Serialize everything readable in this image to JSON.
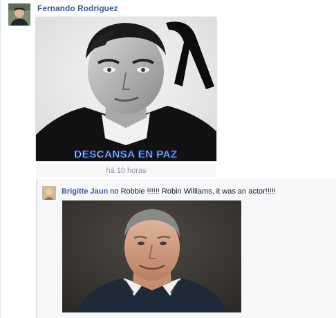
{
  "post": {
    "author": "Fernando Rodriguez",
    "photo_caption": "DESCANSA EN PAZ",
    "timestamp": "há 10 horas"
  },
  "comment": {
    "author": "Brigitte Jaun",
    "text": "no Robbie !!!!!! Robin Williams, it was an actor!!!!!"
  },
  "colors": {
    "link_blue": "#3b5998",
    "meta_gray": "#90949c",
    "panel_bg": "#f6f7f9"
  }
}
